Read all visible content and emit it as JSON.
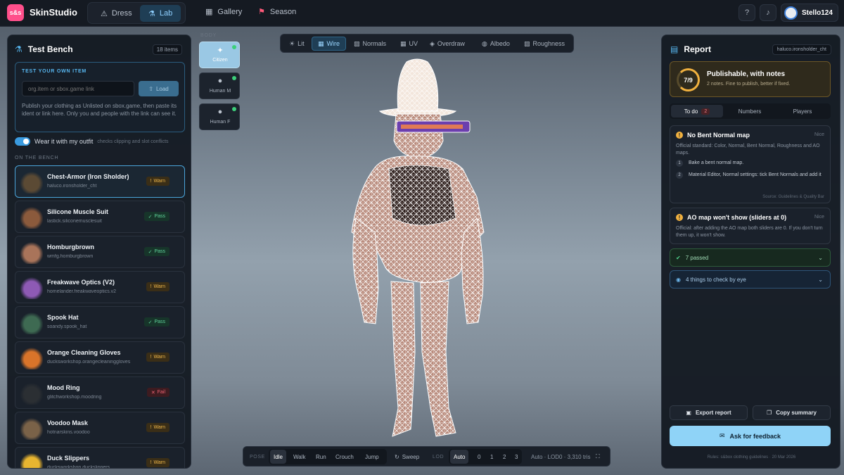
{
  "app": {
    "logo_text": "s&s",
    "brand": "SkinStudio"
  },
  "nav": {
    "modes": [
      {
        "label": "Dress"
      },
      {
        "label": "Lab",
        "active": true
      }
    ],
    "links": [
      {
        "label": "Gallery"
      },
      {
        "label": "Season"
      }
    ]
  },
  "user": {
    "name": "Stello124"
  },
  "bench": {
    "title": "Test Bench",
    "count": "18 items",
    "test_title": "TEST YOUR OWN ITEM",
    "input_placeholder": "org.item or sbox.game link",
    "load_label": "Load",
    "help": "Publish your clothing as Unlisted on sbox.game, then paste its ident or link here. Only you and people with the link can see it.",
    "toggle_label": "Wear it with my outfit",
    "toggle_hint": "checks clipping and slot conflicts",
    "section_label": "ON THE BENCH",
    "items": [
      {
        "name": "Chest-Armor (Iron Sholder)",
        "id": "haluco.ironsholder_cht",
        "status": "Warn",
        "kind": "warn",
        "color": "#5b4a34"
      },
      {
        "name": "Silicone Muscle Suit",
        "id": "lastick.siliconemusclesuit",
        "status": "Pass",
        "kind": "pass",
        "color": "#8b5a3c"
      },
      {
        "name": "Homburgbrown",
        "id": "wmfg.homburgbrown",
        "status": "Pass",
        "kind": "pass",
        "color": "#a9745a"
      },
      {
        "name": "Freakwave Optics (V2)",
        "id": "homelander.freakwaveoptics.v2",
        "status": "Warn",
        "kind": "warn",
        "color": "#8e5ab5"
      },
      {
        "name": "Spook Hat",
        "id": "soandy.spook_hat",
        "status": "Pass",
        "kind": "pass",
        "color": "#3e6a52"
      },
      {
        "name": "Orange Cleaning Gloves",
        "id": "ducksworkshop.orangecleaninggloves",
        "status": "Warn",
        "kind": "warn",
        "color": "#d9742a"
      },
      {
        "name": "Mood Ring",
        "id": "glitchworkshop.moodring",
        "status": "Fail",
        "kind": "fail",
        "color": "#2b2f33"
      },
      {
        "name": "Voodoo Mask",
        "id": "hotnarskins.voodoo",
        "status": "Warn",
        "kind": "warn",
        "color": "#7a6248"
      },
      {
        "name": "Duck Slippers",
        "id": "ducksworkshop.duckslippers",
        "status": "Warn",
        "kind": "warn",
        "color": "#e8b530"
      }
    ]
  },
  "body": {
    "label": "BODY",
    "options": [
      {
        "label": "Citizen",
        "active": true
      },
      {
        "label": "Human M"
      },
      {
        "label": "Human F"
      }
    ]
  },
  "view_modes": [
    {
      "label": "Lit"
    },
    {
      "label": "Wire",
      "active": true
    },
    {
      "label": "Normals"
    },
    {
      "label": "UV"
    },
    {
      "label": "Overdraw"
    },
    {
      "label": "Albedo"
    },
    {
      "label": "Roughness"
    }
  ],
  "bottom": {
    "pose_label": "POSE",
    "poses": [
      {
        "label": "Idle",
        "active": true
      },
      {
        "label": "Walk"
      },
      {
        "label": "Run"
      },
      {
        "label": "Crouch"
      },
      {
        "label": "Jump"
      }
    ],
    "sweep_label": "Sweep",
    "lod_label": "LOD",
    "lods": [
      {
        "label": "Auto",
        "active": true
      },
      {
        "label": "0"
      },
      {
        "label": "1"
      },
      {
        "label": "2"
      },
      {
        "label": "3"
      }
    ],
    "tris": "Auto · LOD0 · 3,310 tris"
  },
  "report": {
    "title": "Report",
    "item_id": "haluco.ironsholder_cht",
    "score": "7/9",
    "score_title": "Publishable, with notes",
    "score_sub": "2 notes. Fine to publish, better if fixed.",
    "tabs": [
      {
        "label": "To do",
        "count": "2",
        "active": true
      },
      {
        "label": "Numbers"
      },
      {
        "label": "Players"
      }
    ],
    "issue1": {
      "title": "No Bent Normal map",
      "tag": "Nice",
      "body": "Official standard: Color, Normal, Bent Normal, Roughness and AO maps.",
      "steps": [
        "Bake a bent normal map.",
        "Material Editor, Normal settings: tick Bent Normals and add it"
      ],
      "source": "Source: Guidelines & Quality Bar"
    },
    "issue2": {
      "title": "AO map won't show (sliders at 0)",
      "tag": "Nice",
      "body": "Official: after adding the AO map both sliders are 0. If you don't turn them up, it won't show."
    },
    "passed_label": "7 passed",
    "eye_label": "4 things to check by eye",
    "export_label": "Export report",
    "copy_label": "Copy summary",
    "feedback_label": "Ask for feedback",
    "rules": "Rules: s&box clothing guidelines · 20 Mar 2026"
  }
}
